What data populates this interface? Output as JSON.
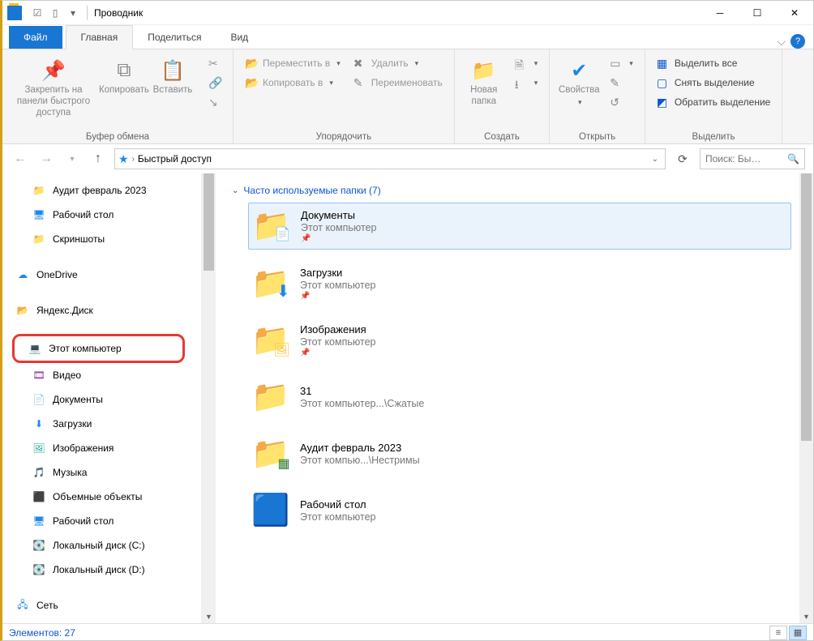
{
  "titlebar": {
    "title": "Проводник"
  },
  "tabs": {
    "file": "Файл",
    "home": "Главная",
    "share": "Поделиться",
    "view": "Вид"
  },
  "ribbon": {
    "clipboard": {
      "label": "Буфер обмена",
      "pin": "Закрепить на панели быстрого доступа",
      "copy": "Копировать",
      "paste": "Вставить"
    },
    "organize": {
      "label": "Упорядочить",
      "move": "Переместить в",
      "copy_to": "Копировать в",
      "delete": "Удалить",
      "rename": "Переименовать"
    },
    "new": {
      "label": "Создать",
      "new_folder": "Новая папка"
    },
    "open": {
      "label": "Открыть",
      "properties": "Свойства"
    },
    "select": {
      "label": "Выделить",
      "select_all": "Выделить все",
      "select_none": "Снять выделение",
      "invert": "Обратить выделение"
    }
  },
  "breadcrumb": {
    "location": "Быстрый доступ"
  },
  "search": {
    "placeholder": "Поиск: Бы…"
  },
  "tree": {
    "items": [
      {
        "label": "Аудит февраль 2023",
        "icon": "folder",
        "indent": 1
      },
      {
        "label": "Рабочий стол",
        "icon": "desktop",
        "indent": 1
      },
      {
        "label": "Скриншоты",
        "icon": "folder-green",
        "indent": 1
      },
      {
        "label": "OneDrive",
        "icon": "onedrive",
        "indent": 0
      },
      {
        "label": "Яндекс.Диск",
        "icon": "yadisk",
        "indent": 0
      },
      {
        "label": "Этот компьютер",
        "icon": "pc",
        "indent": 0,
        "highlight": true
      },
      {
        "label": "Видео",
        "icon": "video",
        "indent": 1
      },
      {
        "label": "Документы",
        "icon": "doc",
        "indent": 1
      },
      {
        "label": "Загрузки",
        "icon": "download",
        "indent": 1
      },
      {
        "label": "Изображения",
        "icon": "image",
        "indent": 1
      },
      {
        "label": "Музыка",
        "icon": "music",
        "indent": 1
      },
      {
        "label": "Объемные объекты",
        "icon": "3d",
        "indent": 1
      },
      {
        "label": "Рабочий стол",
        "icon": "desktop",
        "indent": 1
      },
      {
        "label": "Локальный диск (C:)",
        "icon": "disk",
        "indent": 1
      },
      {
        "label": "Локальный диск (D:)",
        "icon": "disk",
        "indent": 1
      },
      {
        "label": "Сеть",
        "icon": "network",
        "indent": 0
      }
    ]
  },
  "main": {
    "section": "Часто используемые папки (7)",
    "tiles": [
      {
        "name": "Документы",
        "sub": "Этот компьютер",
        "pin": true,
        "icon": "doc",
        "selected": true
      },
      {
        "name": "Загрузки",
        "sub": "Этот компьютер",
        "pin": true,
        "icon": "download",
        "selected": false
      },
      {
        "name": "Изображения",
        "sub": "Этот компьютер",
        "pin": true,
        "icon": "image",
        "selected": false
      },
      {
        "name": "31",
        "sub": "Этот компьютер...\\Сжатые",
        "pin": false,
        "icon": "folder",
        "selected": false
      },
      {
        "name": "Аудит февраль 2023",
        "sub": "Этот компью...\\Нестримы",
        "pin": false,
        "icon": "excel",
        "selected": false
      },
      {
        "name": "Рабочий стол",
        "sub": "Этот компьютер",
        "pin": false,
        "icon": "desktop-big",
        "selected": false
      }
    ]
  },
  "status": {
    "count": "Элементов: 27"
  }
}
